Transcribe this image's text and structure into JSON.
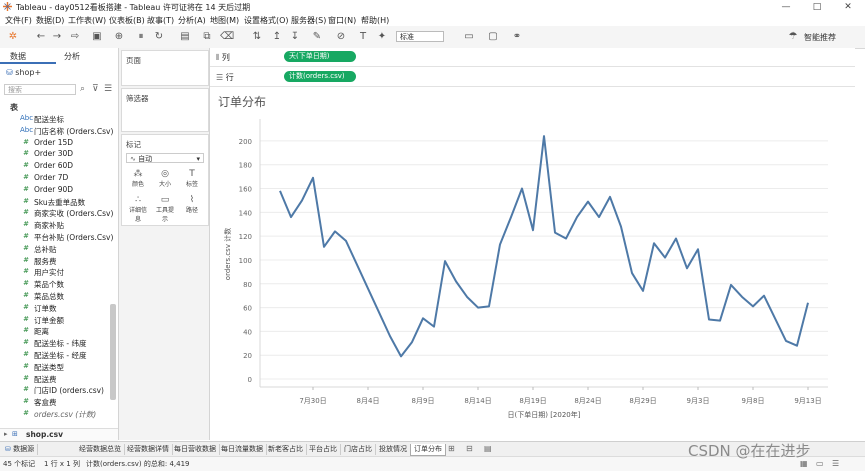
{
  "window": {
    "title": "Tableau - day0512看板搭建 - Tableau 许可证将在 14 天后过期",
    "controls": [
      "—",
      "□",
      "✕"
    ]
  },
  "menu": [
    "文件(F)",
    "数据(D)",
    "工作表(W)",
    "仪表板(B)",
    "故事(T)",
    "分析(A)",
    "地图(M)",
    "设置格式(O)",
    "服务器(S)",
    "窗口(N)",
    "帮助(H)"
  ],
  "toolbar": {
    "fit_select": "标准",
    "show_me": "智能推荐"
  },
  "data_pane": {
    "tabs": [
      "数据",
      "分析"
    ],
    "datasource": "shop+",
    "search_placeholder": "搜索",
    "section": "表",
    "fields": [
      {
        "type": "Abc",
        "name": "配送坐标"
      },
      {
        "type": "Abc",
        "name": "门店名称 (Orders.Csv)"
      },
      {
        "type": "#",
        "name": "Order 15D"
      },
      {
        "type": "#",
        "name": "Order 30D"
      },
      {
        "type": "#",
        "name": "Order 60D"
      },
      {
        "type": "#",
        "name": "Order 7D"
      },
      {
        "type": "#",
        "name": "Order 90D"
      },
      {
        "type": "#",
        "name": "Sku去重单品数"
      },
      {
        "type": "#",
        "name": "商家实收 (Orders.Csv)"
      },
      {
        "type": "#",
        "name": "商家补贴"
      },
      {
        "type": "#",
        "name": "平台补贴 (Orders.Csv)"
      },
      {
        "type": "#",
        "name": "总补贴"
      },
      {
        "type": "#",
        "name": "服务费"
      },
      {
        "type": "#",
        "name": "用户实付"
      },
      {
        "type": "#",
        "name": "菜品个数"
      },
      {
        "type": "#",
        "name": "菜品总数"
      },
      {
        "type": "#",
        "name": "订单数"
      },
      {
        "type": "#",
        "name": "订单金额"
      },
      {
        "type": "#",
        "name": "距离"
      },
      {
        "type": "#",
        "name": "配送坐标 - 纬度"
      },
      {
        "type": "#",
        "name": "配送坐标 - 经度"
      },
      {
        "type": "#",
        "name": "配送类型"
      },
      {
        "type": "#",
        "name": "配送费"
      },
      {
        "type": "#",
        "name": "门店ID (orders.csv)"
      },
      {
        "type": "#",
        "name": "客盒费"
      },
      {
        "type": "#",
        "name": "orders.csv (计数)"
      }
    ],
    "footer_source": "shop.csv"
  },
  "shelves": {
    "pages": "页面",
    "filters": "筛选器",
    "marks": "标记",
    "mark_type": "自动",
    "mark_buttons": [
      "颜色",
      "大小",
      "标签",
      "详细信息",
      "工具提示",
      "路径"
    ],
    "columns_label": "列",
    "rows_label": "行",
    "columns_pill": "天(下单日期)",
    "rows_pill": "计数(orders.csv)"
  },
  "chart_data": {
    "type": "line",
    "title": "订单分布",
    "xlabel": "日(下单日期) [2020年]",
    "ylabel": "orders.csv 计数",
    "ylim": [
      0,
      210
    ],
    "yticks": [
      0,
      20,
      40,
      60,
      80,
      100,
      120,
      140,
      160,
      180,
      200
    ],
    "x_start": "2020-07-27",
    "xtick_labels": [
      {
        "label": "7月30日",
        "day": 3
      },
      {
        "label": "8月4日",
        "day": 8
      },
      {
        "label": "8月9日",
        "day": 13
      },
      {
        "label": "8月14日",
        "day": 18
      },
      {
        "label": "8月19日",
        "day": 23
      },
      {
        "label": "8月24日",
        "day": 28
      },
      {
        "label": "8月29日",
        "day": 33
      },
      {
        "label": "9月3日",
        "day": 38
      },
      {
        "label": "9月8日",
        "day": 43
      },
      {
        "label": "9月13日",
        "day": 48
      }
    ],
    "grid": true,
    "color": "#4e79a7",
    "values": [
      158,
      136,
      150,
      169,
      111,
      124,
      116,
      96,
      76,
      56,
      36,
      19,
      31,
      51,
      44,
      99,
      82,
      69,
      60,
      61,
      113,
      136,
      160,
      125,
      204,
      123,
      118,
      136,
      149,
      136,
      153,
      128,
      89,
      74,
      114,
      102,
      118,
      93,
      109,
      50,
      49,
      79,
      69,
      61,
      70,
      51,
      32,
      28,
      64
    ]
  },
  "sheet_tabs": [
    "数据源",
    "经营数据总览",
    "经营数据详情",
    "每日营收数据",
    "每日流量数据",
    "新老客占比",
    "平台占比",
    "门店占比",
    "投放情况",
    "订单分布"
  ],
  "active_tab": "订单分布",
  "status": {
    "marks": "45 个标记",
    "rows_cols": "1 行 x 1 列",
    "sum": "计数(orders.csv) 的总和: 4,419"
  },
  "watermark": "CSDN @在在进步"
}
